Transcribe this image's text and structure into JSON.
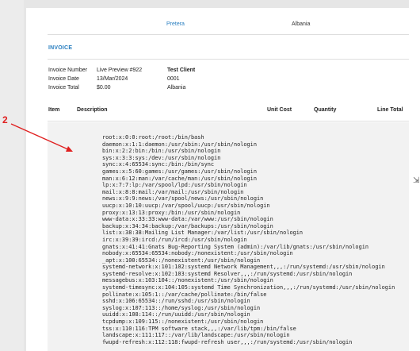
{
  "header": {
    "city": "Pretera",
    "country": "Albania"
  },
  "invoice": {
    "title": "INVOICE",
    "rows": [
      {
        "label": "Invoice Number",
        "value": "Live Preview #922",
        "client": "Test Client"
      },
      {
        "label": "Invoice Date",
        "value": "13/Mar/2024",
        "client": "0001"
      },
      {
        "label": "Invoice Total",
        "value": "$0.00",
        "client": "Albania"
      }
    ]
  },
  "columns": {
    "item": "Item",
    "description": "Description",
    "unit_cost": "Unit Cost",
    "quantity": "Quantity",
    "line_total": "Line Total"
  },
  "annotation": {
    "marker": "2"
  },
  "description_lines": [
    "root:x:0:0:root:/root:/bin/bash",
    "daemon:x:1:1:daemon:/usr/sbin:/usr/sbin/nologin",
    "bin:x:2:2:bin:/bin:/usr/sbin/nologin",
    "sys:x:3:3:sys:/dev:/usr/sbin/nologin",
    "sync:x:4:65534:sync:/bin:/bin/sync",
    "games:x:5:60:games:/usr/games:/usr/sbin/nologin",
    "man:x:6:12:man:/var/cache/man:/usr/sbin/nologin",
    "lp:x:7:7:lp:/var/spool/lpd:/usr/sbin/nologin",
    "mail:x:8:8:mail:/var/mail:/usr/sbin/nologin",
    "news:x:9:9:news:/var/spool/news:/usr/sbin/nologin",
    "uucp:x:10:10:uucp:/var/spool/uucp:/usr/sbin/nologin",
    "proxy:x:13:13:proxy:/bin:/usr/sbin/nologin",
    "www-data:x:33:33:www-data:/var/www:/usr/sbin/nologin",
    "backup:x:34:34:backup:/var/backups:/usr/sbin/nologin",
    "list:x:38:38:Mailing List Manager:/var/list:/usr/sbin/nologin",
    "irc:x:39:39:ircd:/run/ircd:/usr/sbin/nologin",
    "gnats:x:41:41:Gnats Bug-Reporting System (admin):/var/lib/gnats:/usr/sbin/nologin",
    "nobody:x:65534:65534:nobody:/nonexistent:/usr/sbin/nologin",
    "_apt:x:100:65534::/nonexistent:/usr/sbin/nologin",
    "systemd-network:x:101:102:systemd Network Management,,,:/run/systemd:/usr/sbin/nologin",
    "systemd-resolve:x:102:103:systemd Resolver,,,:/run/systemd:/usr/sbin/nologin",
    "messagebus:x:103:104::/nonexistent:/usr/sbin/nologin",
    "systemd-timesync:x:104:105:systemd Time Synchronization,,,:/run/systemd:/usr/sbin/nologin",
    "pollinate:x:105:1::/var/cache/pollinate:/bin/false",
    "sshd:x:106:65534::/run/sshd:/usr/sbin/nologin",
    "syslog:x:107:113::/home/syslog:/usr/sbin/nologin",
    "uuidd:x:108:114::/run/uuidd:/usr/sbin/nologin",
    "tcpdump:x:109:115::/nonexistent:/usr/sbin/nologin",
    "tss:x:110:116:TPM software stack,,,:/var/lib/tpm:/bin/false",
    "landscape:x:111:117::/var/lib/landscape:/usr/sbin/nologin",
    "fwupd-refresh:x:112:118:fwupd-refresh user,,,:/run/systemd:/usr/sbin/nologin"
  ]
}
